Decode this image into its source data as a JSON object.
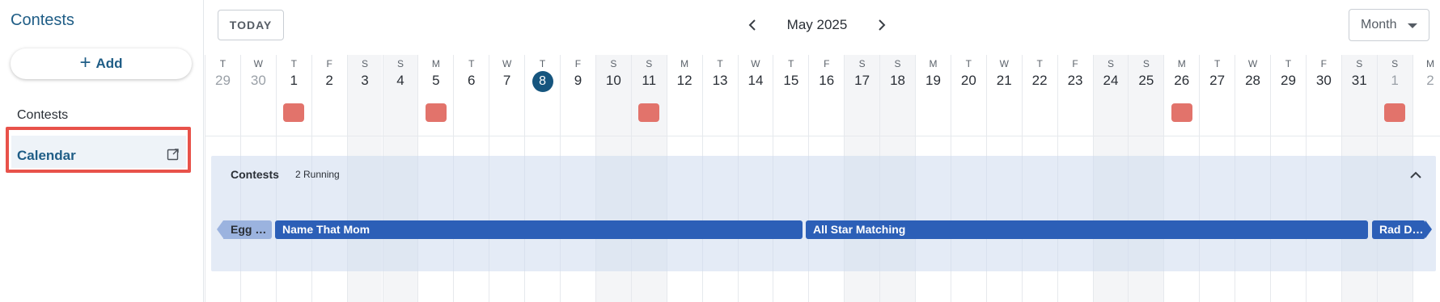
{
  "sidebar": {
    "title": "Contests",
    "add_label": "Add",
    "items": [
      {
        "label": "Contests"
      },
      {
        "label": "Calendar"
      }
    ]
  },
  "toolbar": {
    "today_label": "TODAY",
    "month_label": "May 2025",
    "view_value": "Month"
  },
  "calendar": {
    "days": [
      {
        "dow": "T",
        "num": "29",
        "muted": true,
        "weekend": false,
        "marker": false
      },
      {
        "dow": "W",
        "num": "30",
        "muted": true,
        "weekend": false,
        "marker": false
      },
      {
        "dow": "T",
        "num": "1",
        "muted": false,
        "weekend": false,
        "marker": true
      },
      {
        "dow": "F",
        "num": "2",
        "muted": false,
        "weekend": false,
        "marker": false
      },
      {
        "dow": "S",
        "num": "3",
        "muted": false,
        "weekend": true,
        "marker": false
      },
      {
        "dow": "S",
        "num": "4",
        "muted": false,
        "weekend": true,
        "marker": false
      },
      {
        "dow": "M",
        "num": "5",
        "muted": false,
        "weekend": false,
        "marker": true
      },
      {
        "dow": "T",
        "num": "6",
        "muted": false,
        "weekend": false,
        "marker": false
      },
      {
        "dow": "W",
        "num": "7",
        "muted": false,
        "weekend": false,
        "marker": false
      },
      {
        "dow": "T",
        "num": "8",
        "muted": false,
        "weekend": false,
        "marker": false,
        "today": true
      },
      {
        "dow": "F",
        "num": "9",
        "muted": false,
        "weekend": false,
        "marker": false
      },
      {
        "dow": "S",
        "num": "10",
        "muted": false,
        "weekend": true,
        "marker": false
      },
      {
        "dow": "S",
        "num": "11",
        "muted": false,
        "weekend": true,
        "marker": true
      },
      {
        "dow": "M",
        "num": "12",
        "muted": false,
        "weekend": false,
        "marker": false
      },
      {
        "dow": "T",
        "num": "13",
        "muted": false,
        "weekend": false,
        "marker": false
      },
      {
        "dow": "W",
        "num": "14",
        "muted": false,
        "weekend": false,
        "marker": false
      },
      {
        "dow": "T",
        "num": "15",
        "muted": false,
        "weekend": false,
        "marker": false
      },
      {
        "dow": "F",
        "num": "16",
        "muted": false,
        "weekend": false,
        "marker": false
      },
      {
        "dow": "S",
        "num": "17",
        "muted": false,
        "weekend": true,
        "marker": false
      },
      {
        "dow": "S",
        "num": "18",
        "muted": false,
        "weekend": true,
        "marker": false
      },
      {
        "dow": "M",
        "num": "19",
        "muted": false,
        "weekend": false,
        "marker": false
      },
      {
        "dow": "T",
        "num": "20",
        "muted": false,
        "weekend": false,
        "marker": false
      },
      {
        "dow": "W",
        "num": "21",
        "muted": false,
        "weekend": false,
        "marker": false
      },
      {
        "dow": "T",
        "num": "22",
        "muted": false,
        "weekend": false,
        "marker": false
      },
      {
        "dow": "F",
        "num": "23",
        "muted": false,
        "weekend": false,
        "marker": false
      },
      {
        "dow": "S",
        "num": "24",
        "muted": false,
        "weekend": true,
        "marker": false
      },
      {
        "dow": "S",
        "num": "25",
        "muted": false,
        "weekend": true,
        "marker": false
      },
      {
        "dow": "M",
        "num": "26",
        "muted": false,
        "weekend": false,
        "marker": true
      },
      {
        "dow": "T",
        "num": "27",
        "muted": false,
        "weekend": false,
        "marker": false
      },
      {
        "dow": "W",
        "num": "28",
        "muted": false,
        "weekend": false,
        "marker": false
      },
      {
        "dow": "T",
        "num": "29",
        "muted": false,
        "weekend": false,
        "marker": false
      },
      {
        "dow": "F",
        "num": "30",
        "muted": false,
        "weekend": false,
        "marker": false
      },
      {
        "dow": "S",
        "num": "31",
        "muted": false,
        "weekend": true,
        "marker": false
      },
      {
        "dow": "S",
        "num": "1",
        "muted": true,
        "weekend": true,
        "marker": true
      },
      {
        "dow": "M",
        "num": "2",
        "muted": true,
        "weekend": false,
        "marker": false
      }
    ]
  },
  "contests_section": {
    "title": "Contests",
    "count_label": "2 Running",
    "bars": [
      {
        "label": "Egg …"
      },
      {
        "label": "Name That Mom"
      },
      {
        "label": "All Star Matching"
      },
      {
        "label": "Rad D…"
      }
    ]
  },
  "colors": {
    "accent": "#1f5d86",
    "today": "#16557e",
    "marker": "#e2736b",
    "bar": "#2c5fb7",
    "bar_faded": "#9bb3df",
    "highlight": "#e8524a"
  }
}
